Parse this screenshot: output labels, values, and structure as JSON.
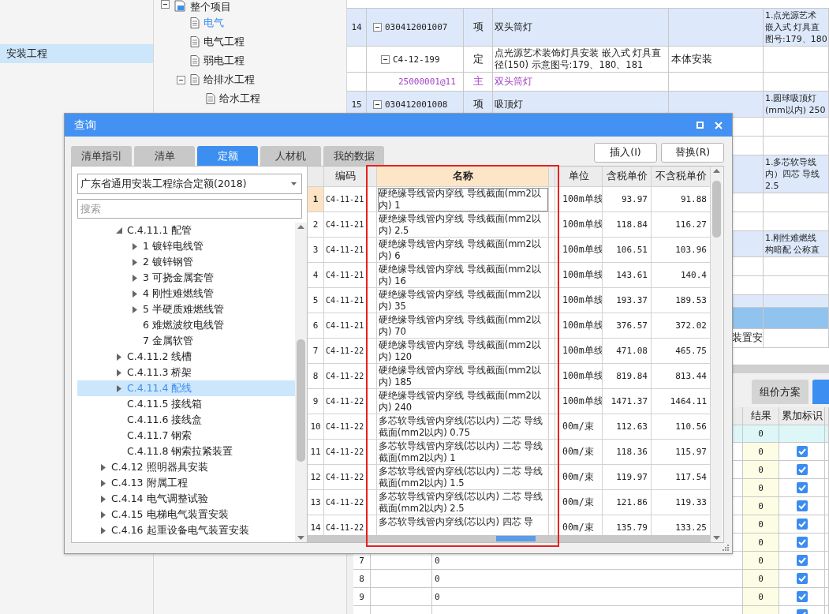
{
  "nav": {
    "items": [
      {
        "label": "安装工程",
        "selected": true
      }
    ]
  },
  "project_tree": {
    "root": {
      "label": "整个项目",
      "expanded": true,
      "selected": false,
      "children": [
        {
          "label": "电气",
          "selected": true
        },
        {
          "label": "电气工程",
          "selected": false
        },
        {
          "label": "弱电工程",
          "selected": false
        },
        {
          "label": "给排水工程",
          "expanded": true,
          "selected": false,
          "children": [
            {
              "label": "给水工程",
              "selected": false
            }
          ]
        }
      ]
    }
  },
  "bill_grid": {
    "rows": [
      {
        "kind": "item",
        "selected": false,
        "num": "14",
        "code": "030412001007",
        "type": "项",
        "name": "双头筒灯",
        "description_lines": [
          "1.点光源艺术",
          "嵌入式 灯具直",
          "图号:179、180"
        ]
      },
      {
        "kind": "quota",
        "selected": false,
        "code": "C4-12-199",
        "type": "定",
        "name": "点光源艺术装饰灯具安装 嵌入式 灯具直径(150) 示意图号:179、180、181",
        "feature": "本体安装"
      },
      {
        "kind": "material",
        "selected": false,
        "code": "25000001@11",
        "type": "主",
        "name": "双头筒灯"
      },
      {
        "kind": "item",
        "selected": false,
        "num": "15",
        "code": "030412001008",
        "type": "项",
        "name": "吸顶灯",
        "description_lines": [
          "1.圆球吸顶灯",
          "(mm以内) 250"
        ]
      },
      {
        "kind": "quota",
        "selected": false
      },
      {
        "kind": "material",
        "selected": false
      },
      {
        "kind": "item",
        "selected": false,
        "description_lines": [
          "1.多芯软导线",
          "内）四芯 导线",
          "2.5"
        ]
      },
      {
        "kind": "quota",
        "selected": false
      },
      {
        "kind": "material",
        "selected": false
      },
      {
        "kind": "item",
        "selected": false,
        "description_lines": [
          "1.刚性难燃线",
          "构暗配 公称直"
        ]
      },
      {
        "kind": "quota",
        "selected": false
      },
      {
        "kind": "material",
        "selected": false
      },
      {
        "kind": "item",
        "selected": false
      },
      {
        "kind": "item",
        "selected": true
      },
      {
        "kind": "quota",
        "selected": false,
        "feature": "装置安"
      }
    ]
  },
  "detail_panel": {
    "tabs": [
      {
        "label": "组价方案",
        "selected": false
      },
      {
        "selected": true
      }
    ],
    "columns": [
      "结果",
      "累加标识"
    ],
    "rows": [
      {
        "kind": "summary",
        "result": "0"
      },
      {
        "kind": "entry",
        "result": "0",
        "checked": true
      },
      {
        "kind": "entry",
        "result": "0",
        "checked": true
      },
      {
        "kind": "entry",
        "result": "0",
        "checked": true
      },
      {
        "kind": "entry",
        "result": "0",
        "checked": true
      },
      {
        "kind": "entry",
        "result": "0",
        "checked": true
      },
      {
        "kind": "entry",
        "result": "0",
        "checked": true
      },
      {
        "kind": "entry",
        "num": "7",
        "value": "0",
        "result": "0",
        "checked": true
      },
      {
        "kind": "entry",
        "num": "8",
        "value": "0",
        "result": "0",
        "checked": true
      },
      {
        "kind": "entry",
        "num": "9",
        "value": "0",
        "result": "0",
        "checked": true
      },
      {
        "kind": "entry",
        "checked": true
      }
    ]
  },
  "dialog": {
    "title": "查询",
    "tabs": [
      {
        "label": "清单指引",
        "selected": false
      },
      {
        "label": "清单",
        "selected": false
      },
      {
        "label": "定额",
        "selected": true
      },
      {
        "label": "人材机",
        "selected": false
      },
      {
        "label": "我的数据",
        "selected": false
      }
    ],
    "buttons": [
      "插入(I)",
      "替换(R)"
    ],
    "library": "广东省通用安装工程综合定额(2018)",
    "search": {
      "placeholder": "搜索"
    },
    "tree": [
      {
        "children": [
          {
            "label": "C.4.11.1 配管",
            "expanded": true,
            "selected": false,
            "children": [
              {
                "label": "1 镀锌电线管",
                "expanded": false,
                "selected": false
              },
              {
                "label": "2 镀锌钢管",
                "expanded": false,
                "selected": false
              },
              {
                "label": "3 可挠金属套管",
                "expanded": false,
                "selected": false
              },
              {
                "label": "4 刚性难燃线管",
                "expanded": false,
                "selected": false
              },
              {
                "label": "5 半硬质难燃线管",
                "expanded": false,
                "selected": false
              },
              {
                "label": "6 难燃波纹电线管",
                "selected": false
              },
              {
                "label": "7 金属软管",
                "selected": false
              }
            ]
          },
          {
            "label": "C.4.11.2 线槽",
            "expanded": false,
            "selected": false
          },
          {
            "label": "C.4.11.3 桥架",
            "expanded": false,
            "selected": false
          },
          {
            "label": "C.4.11.4 配线",
            "expanded": false,
            "selected": true
          },
          {
            "label": "C.4.11.5 接线箱",
            "selected": false
          },
          {
            "label": "C.4.11.6 接线盒",
            "selected": false
          },
          {
            "label": "C.4.11.7 钢索",
            "selected": false
          },
          {
            "label": "C.4.11.8 钢索拉紧装置",
            "selected": false
          }
        ]
      },
      {
        "label": "C.4.12 照明器具安装",
        "expanded": false,
        "selected": false
      },
      {
        "label": "C.4.13 附属工程",
        "expanded": false,
        "selected": false
      },
      {
        "label": "C.4.14 电气调整试验",
        "expanded": false,
        "selected": false
      },
      {
        "label": "C.4.15 电梯电气装置安装",
        "expanded": false,
        "selected": false
      },
      {
        "label": "C.4.16 起重设备电气装置安装",
        "expanded": false,
        "selected": false
      }
    ],
    "table": {
      "columns": [
        "编码",
        "名称",
        "单位",
        "含税单价",
        "不含税单价"
      ],
      "rows": [
        {
          "num": "1",
          "code": "C4-11-21",
          "name": "硬绝缘导线管内穿线 导线截面(mm2以内) 1",
          "unit": "100m单线",
          "price_tax": "93.97",
          "price_notax": "91.88",
          "selected": true
        },
        {
          "num": "2",
          "code": "C4-11-21",
          "name": "硬绝缘导线管内穿线 导线截面(mm2以内) 2.5",
          "unit": "100m单线",
          "price_tax": "118.84",
          "price_notax": "116.27",
          "selected": false
        },
        {
          "num": "3",
          "code": "C4-11-21",
          "name": "硬绝缘导线管内穿线 导线截面(mm2以内) 6",
          "unit": "100m单线",
          "price_tax": "106.51",
          "price_notax": "103.96",
          "selected": false
        },
        {
          "num": "4",
          "code": "C4-11-21",
          "name": "硬绝缘导线管内穿线 导线截面(mm2以内) 16",
          "unit": "100m单线",
          "price_tax": "143.61",
          "price_notax": "140.4",
          "selected": false
        },
        {
          "num": "5",
          "code": "C4-11-21",
          "name": "硬绝缘导线管内穿线 导线截面(mm2以内) 35",
          "unit": "100m单线",
          "price_tax": "193.37",
          "price_notax": "189.53",
          "selected": false
        },
        {
          "num": "6",
          "code": "C4-11-21",
          "name": "硬绝缘导线管内穿线 导线截面(mm2以内) 70",
          "unit": "100m单线",
          "price_tax": "376.57",
          "price_notax": "372.02",
          "selected": false
        },
        {
          "num": "7",
          "code": "C4-11-22",
          "name": "硬绝缘导线管内穿线 导线截面(mm2以内) 120",
          "unit": "100m单线",
          "price_tax": "471.08",
          "price_notax": "465.75",
          "selected": false
        },
        {
          "num": "8",
          "code": "C4-11-22",
          "name": "硬绝缘导线管内穿线 导线截面(mm2以内) 185",
          "unit": "100m单线",
          "price_tax": "819.84",
          "price_notax": "813.44",
          "selected": false
        },
        {
          "num": "9",
          "code": "C4-11-22",
          "name": "硬绝缘导线管内穿线 导线截面(mm2以内) 240",
          "unit": "100m单线",
          "price_tax": "1471.37",
          "price_notax": "1464.11",
          "selected": false
        },
        {
          "num": "10",
          "code": "C4-11-22",
          "name": "多芯软导线管内穿线(芯以内) 二芯 导线截面(mm2以内) 0.75",
          "unit": "00m/束",
          "price_tax": "112.63",
          "price_notax": "110.56",
          "selected": false
        },
        {
          "num": "11",
          "code": "C4-11-22",
          "name": "多芯软导线管内穿线(芯以内) 二芯 导线截面(mm2以内) 1",
          "unit": "00m/束",
          "price_tax": "118.36",
          "price_notax": "115.97",
          "selected": false
        },
        {
          "num": "12",
          "code": "C4-11-22",
          "name": "多芯软导线管内穿线(芯以内) 二芯 导线截面(mm2以内) 1.5",
          "unit": "00m/束",
          "price_tax": "119.97",
          "price_notax": "117.54",
          "selected": false
        },
        {
          "num": "13",
          "code": "C4-11-22",
          "name": "多芯软导线管内穿线(芯以内) 二芯 导线截面(mm2以内) 2.5",
          "unit": "00m/束",
          "price_tax": "121.86",
          "price_notax": "119.33",
          "selected": false
        },
        {
          "num": "14",
          "code": "C4-11-22",
          "name": "多芯软导线管内穿线(芯以内) 四芯 导",
          "unit": "00m/束",
          "price_tax": "135.79",
          "price_notax": "133.25",
          "selected": false
        }
      ]
    }
  }
}
